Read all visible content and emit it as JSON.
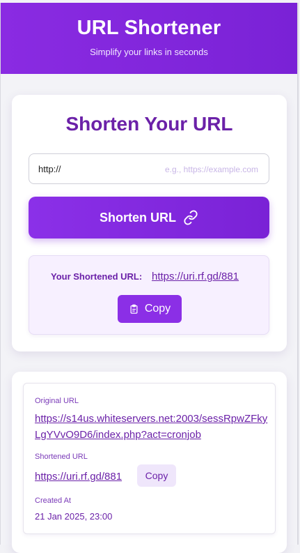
{
  "header": {
    "title": "URL Shortener",
    "subtitle": "Simplify your links in seconds"
  },
  "form": {
    "heading": "Shorten Your URL",
    "input_value": "http://",
    "input_placeholder": "e.g., https://example.com",
    "button_label": "Shorten URL"
  },
  "result": {
    "label": "Your Shortened URL:",
    "short_url": "https://uri.rf.gd/881",
    "copy_label": "Copy"
  },
  "history": {
    "items": [
      {
        "original_label": "Original URL",
        "original_url": "https://s14us.whiteservers.net:2003/sessRpwZFkyLgYVvO9D6/index.php?act=cronjob",
        "short_label": "Shortened URL",
        "short_url": "https://uri.rf.gd/881",
        "copy_label": "Copy",
        "created_label": "Created At",
        "created_at": "21 Jan 2025, 23:00"
      }
    ]
  },
  "colors": {
    "accent": "#7a22d6",
    "heading": "#6b21a8",
    "result_bg": "#f7f0ff"
  }
}
